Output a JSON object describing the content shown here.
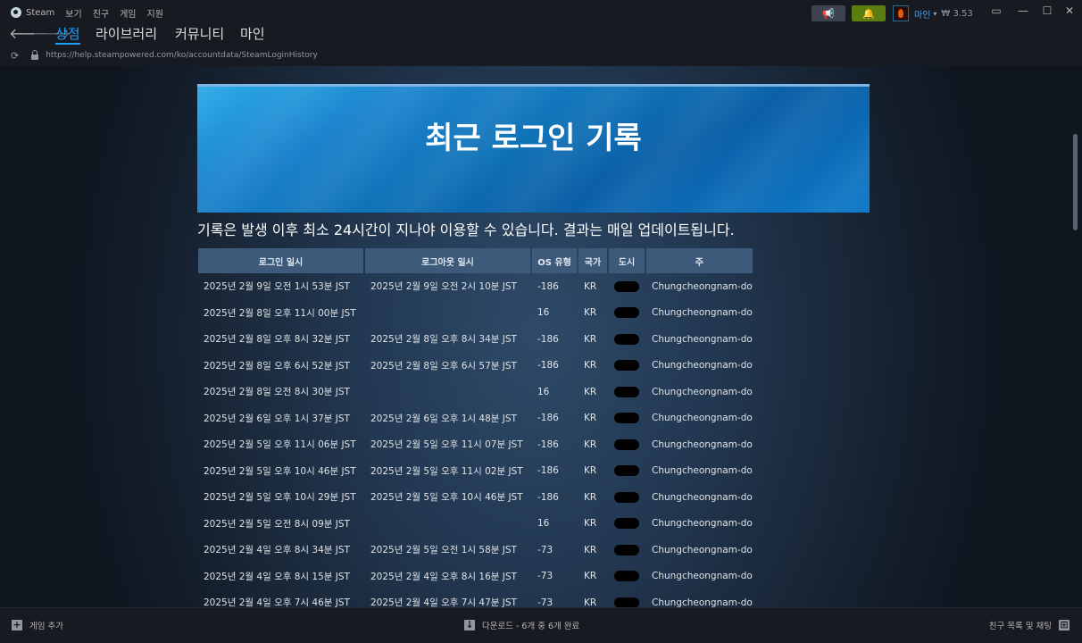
{
  "menu": {
    "app": "Steam",
    "items": [
      "보기",
      "친구",
      "게임",
      "지원"
    ]
  },
  "account": {
    "name": "마인",
    "wallet": "₩ 3.53"
  },
  "nav": {
    "tabs": [
      "상점",
      "라이브러리",
      "커뮤니티",
      "마인"
    ],
    "active_tab": "상점"
  },
  "url": "https://help.steampowered.com/ko/accountdata/SteamLoginHistory",
  "page": {
    "title": "최근 로그인 기록",
    "notice": "기록은 발생 이후 최소 24시간이 지나야 이용할 수 있습니다. 결과는 매일 업데이트됩니다."
  },
  "table": {
    "headers": [
      "로그인 일시",
      "로그아웃 일시",
      "OS 유형",
      "국가",
      "도시",
      "주"
    ],
    "rows": [
      [
        "2025년 2월 9일 오전 1시 53분 JST",
        "2025년 2월 9일 오전 2시 10분 JST",
        "-186",
        "KR",
        "",
        "Chungcheongnam-do"
      ],
      [
        "2025년 2월 8일 오후 11시 00분 JST",
        "",
        "16",
        "KR",
        "",
        "Chungcheongnam-do"
      ],
      [
        "2025년 2월 8일 오후 8시 32분 JST",
        "2025년 2월 8일 오후 8시 34분 JST",
        "-186",
        "KR",
        "",
        "Chungcheongnam-do"
      ],
      [
        "2025년 2월 8일 오후 6시 52분 JST",
        "2025년 2월 8일 오후 6시 57분 JST",
        "-186",
        "KR",
        "",
        "Chungcheongnam-do"
      ],
      [
        "2025년 2월 8일 오전 8시 30분 JST",
        "",
        "16",
        "KR",
        "",
        "Chungcheongnam-do"
      ],
      [
        "2025년 2월 6일 오후 1시 37분 JST",
        "2025년 2월 6일 오후 1시 48분 JST",
        "-186",
        "KR",
        "",
        "Chungcheongnam-do"
      ],
      [
        "2025년 2월 5일 오후 11시 06분 JST",
        "2025년 2월 5일 오후 11시 07분 JST",
        "-186",
        "KR",
        "",
        "Chungcheongnam-do"
      ],
      [
        "2025년 2월 5일 오후 10시 46분 JST",
        "2025년 2월 5일 오후 11시 02분 JST",
        "-186",
        "KR",
        "",
        "Chungcheongnam-do"
      ],
      [
        "2025년 2월 5일 오후 10시 29분 JST",
        "2025년 2월 5일 오후 10시 46분 JST",
        "-186",
        "KR",
        "",
        "Chungcheongnam-do"
      ],
      [
        "2025년 2월 5일 오전 8시 09분 JST",
        "",
        "16",
        "KR",
        "",
        "Chungcheongnam-do"
      ],
      [
        "2025년 2월 4일 오후 8시 34분 JST",
        "2025년 2월 5일 오전 1시 58분 JST",
        "-73",
        "KR",
        "",
        "Chungcheongnam-do"
      ],
      [
        "2025년 2월 4일 오후 8시 15분 JST",
        "2025년 2월 4일 오후 8시 16분 JST",
        "-73",
        "KR",
        "",
        "Chungcheongnam-do"
      ],
      [
        "2025년 2월 4일 오후 7시 46분 JST",
        "2025년 2월 4일 오후 7시 47분 JST",
        "-73",
        "KR",
        "",
        "Chungcheongnam-do"
      ]
    ]
  },
  "statusbar": {
    "add_game": "게임 추가",
    "downloads": "다운로드 - 6개 중 6개 완료",
    "friends": "친구 목록 및 채팅"
  },
  "icons": [
    "steam-logo-icon",
    "megaphone-icon",
    "bell-icon",
    "monitor-icon",
    "minimize-icon",
    "maximize-icon",
    "close-icon",
    "back-arrow-icon",
    "forward-arrow-icon",
    "reload-icon",
    "lock-icon",
    "add-icon",
    "download-icon",
    "friends-icon"
  ],
  "colors": {
    "accent": "#1a9fff",
    "notification": "#5c7e10",
    "table_header": "#3d5a7a"
  }
}
